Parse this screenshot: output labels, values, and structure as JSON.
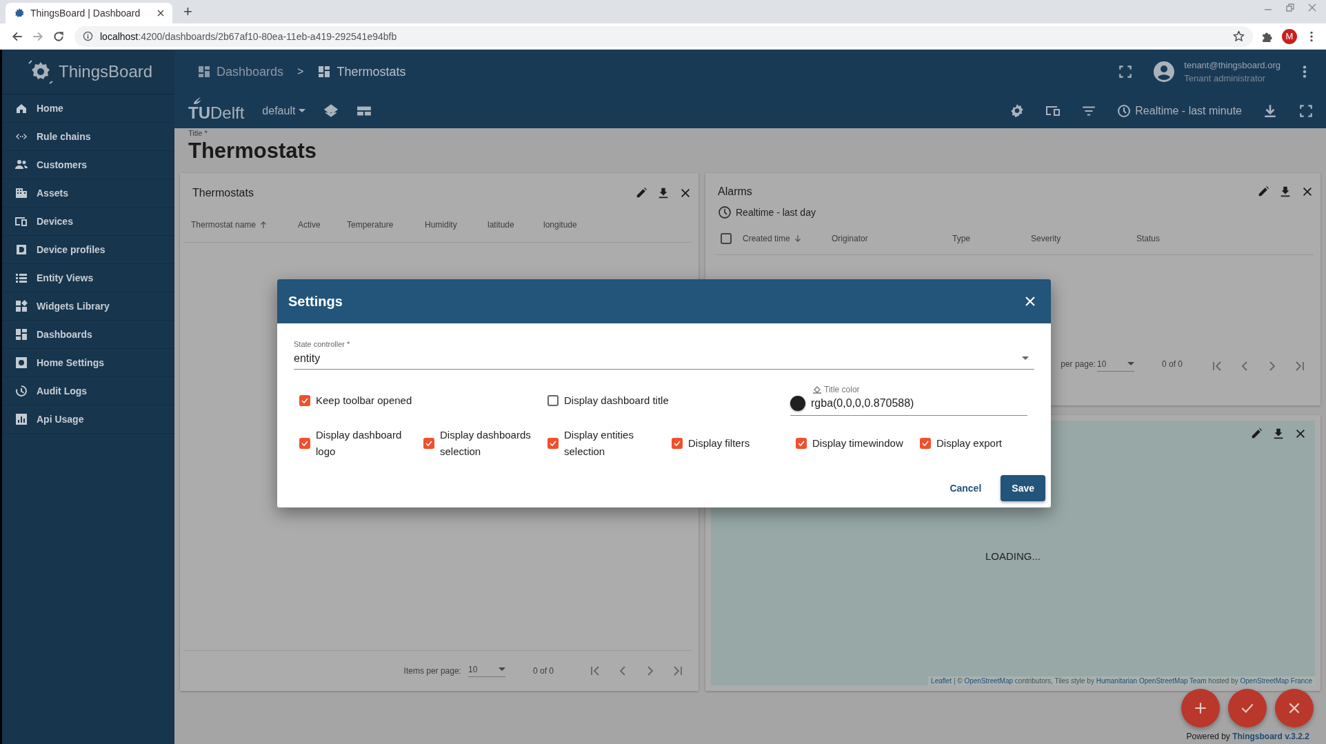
{
  "browser": {
    "tab_title": "ThingsBoard | Dashboard",
    "new_tab": "+",
    "url_host": "localhost",
    "url_rest": ":4200/dashboards/2b67af10-80ea-11eb-a419-292541e94bfb",
    "avatar": "M"
  },
  "sidebar": {
    "logo": "ThingsBoard",
    "items": [
      {
        "label": "Home"
      },
      {
        "label": "Rule chains"
      },
      {
        "label": "Customers"
      },
      {
        "label": "Assets"
      },
      {
        "label": "Devices"
      },
      {
        "label": "Device profiles"
      },
      {
        "label": "Entity Views"
      },
      {
        "label": "Widgets Library"
      },
      {
        "label": "Dashboards"
      },
      {
        "label": "Home Settings"
      },
      {
        "label": "Audit Logs"
      },
      {
        "label": "Api Usage"
      }
    ]
  },
  "header": {
    "breadcrumb": [
      "Dashboards",
      "Thermostats"
    ],
    "separator": ">",
    "user_email": "tenant@thingsboard.org",
    "user_role": "Tenant administrator"
  },
  "toolbar": {
    "logo": "**TU**Delft",
    "state": "default",
    "timewindow": "Realtime - last minute"
  },
  "dashboard": {
    "title_label": "Title *",
    "title": "Thermostats"
  },
  "thermostats_widget": {
    "title": "Thermostats",
    "sort_descending": false,
    "columns": [
      {
        "label": "Thermostat name",
        "sorted": true
      },
      {
        "label": "Active",
        "sorted": false
      },
      {
        "label": "Temperature",
        "sorted": false
      },
      {
        "label": "Humidity",
        "sorted": false
      },
      {
        "label": "latitude",
        "sorted": false
      },
      {
        "label": "longitude",
        "sorted": false
      }
    ],
    "pagination": {
      "label": "Items per page:",
      "page_size": "10",
      "range": "0 of 0"
    }
  },
  "alarms_widget": {
    "title": "Alarms",
    "timewindow": "Realtime - last day",
    "select_all": {
      "checked": false
    },
    "sort_descending": true,
    "columns": [
      {
        "label": "Created time",
        "sorted": true
      },
      {
        "label": "Originator",
        "sorted": false
      },
      {
        "label": "Type",
        "sorted": false
      },
      {
        "label": "Severity",
        "sorted": false
      },
      {
        "label": "Status",
        "sorted": false
      }
    ],
    "pagination": {
      "label": "per page:",
      "page_size": "10",
      "range": "0 of 0"
    }
  },
  "map_widget": {
    "status": "LOADING...",
    "attribution": [
      {
        "text": "Leaflet",
        "kind": "link"
      },
      {
        "text": " | © ",
        "kind": "text"
      },
      {
        "text": "OpenStreetMap",
        "kind": "link"
      },
      {
        "text": " contributors, Tiles style by ",
        "kind": "text"
      },
      {
        "text": "Humanitarian OpenStreetMap Team",
        "kind": "link"
      },
      {
        "text": " hosted by ",
        "kind": "text"
      },
      {
        "text": "OpenStreetMap France",
        "kind": "link"
      }
    ]
  },
  "settings_dialog": {
    "title": "Settings",
    "state_controller": {
      "label": "State controller *",
      "value": "entity"
    },
    "row_1": [
      {
        "label": "Keep toolbar opened",
        "checked": true
      },
      {
        "label": "Display dashboard title",
        "checked": false
      }
    ],
    "title_color": {
      "label": "Title color",
      "value": "rgba(0,0,0,0.870588)",
      "color": "#1f1f1f"
    },
    "row_2": [
      {
        "label": "Display dashboard logo",
        "checked": true
      },
      {
        "label": "Display dashboards selection",
        "checked": true
      },
      {
        "label": "Display entities selection",
        "checked": true
      },
      {
        "label": "Display filters",
        "checked": true
      },
      {
        "label": "Display timewindow",
        "checked": true
      },
      {
        "label": "Display export",
        "checked": true
      }
    ],
    "buttons": {
      "cancel": "Cancel",
      "save": "Save"
    }
  },
  "footer": {
    "prefix": "Powered by",
    "link": "Thingsboard v.3.2.2"
  }
}
